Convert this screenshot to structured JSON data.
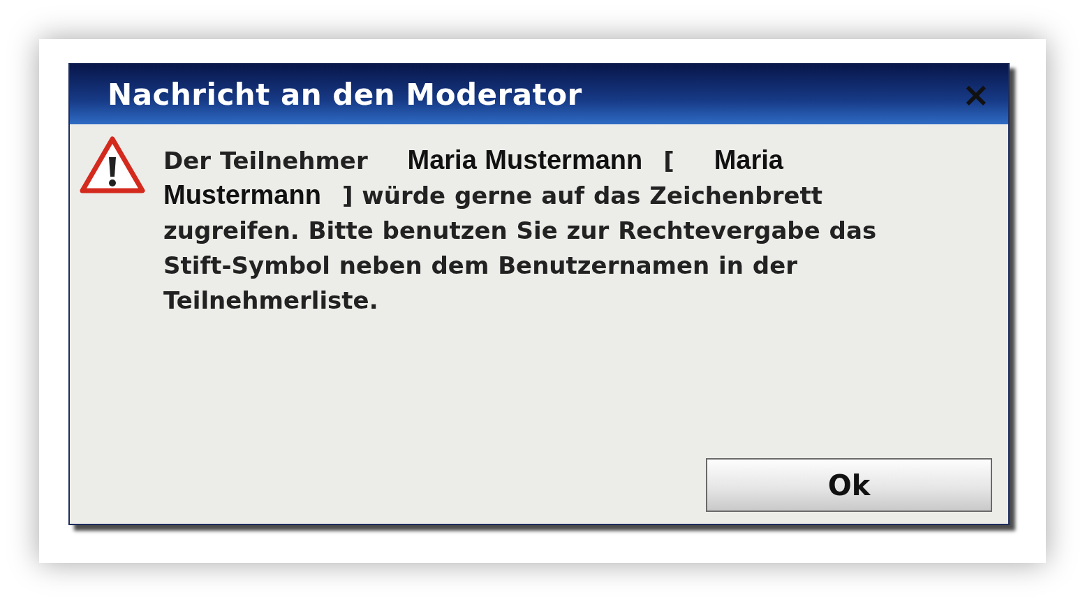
{
  "dialog": {
    "title": "Nachricht an den Moderator",
    "close": "×",
    "message": [
      {
        "kind": "plain",
        "text": "Der Teilnehmer"
      },
      {
        "kind": "name",
        "text": "Maria Mustermann"
      },
      {
        "kind": "plain",
        "text": "["
      },
      {
        "kind": "name",
        "text": "Maria Mustermann"
      },
      {
        "kind": "plain",
        "text": "] würde gerne auf das Zeichenbrett zugreifen. Bitte benutzen Sie zur Rechtevergabe das Stift-Symbol neben dem Benutzernamen in der Teilnehmerliste."
      }
    ],
    "buttons": [
      "Ok"
    ]
  }
}
